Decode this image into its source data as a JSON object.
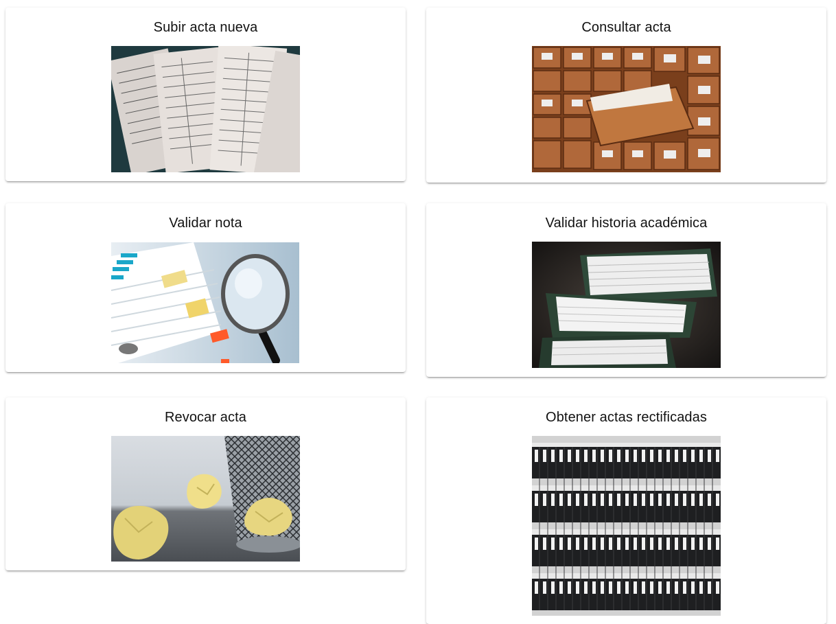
{
  "cards": [
    {
      "title": "Subir acta nueva",
      "image": "stacked-grade-sheets-photo"
    },
    {
      "title": "Consultar acta",
      "image": "card-catalog-drawers-photo"
    },
    {
      "title": "Validar nota",
      "image": "magnifying-glass-documents-photo"
    },
    {
      "title": "Validar historia académica",
      "image": "binders-stacked-papers-photo"
    },
    {
      "title": "Revocar acta",
      "image": "crumpled-paper-wastebasket-photo"
    },
    {
      "title": "Obtener actas rectificadas",
      "image": "archive-binders-shelf-photo"
    }
  ]
}
